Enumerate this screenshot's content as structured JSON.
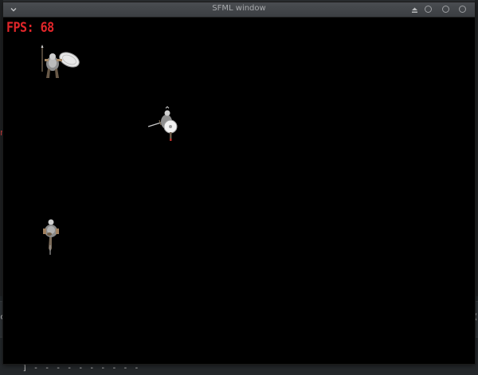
{
  "window": {
    "title": "SFML window",
    "menu_icon": "chevron-down-icon",
    "controls": [
      "eject-icon",
      "minimize-icon",
      "maximize-icon",
      "close-icon"
    ]
  },
  "hud": {
    "fps_label": "FPS: 68",
    "fps_color": "#e2262a"
  },
  "canvas": {
    "background": "#000000"
  },
  "sprites": [
    {
      "name": "knight-with-round-shield",
      "icon": "knight-sprite"
    },
    {
      "name": "knight-with-shield-and-sword",
      "icon": "knight-sprite"
    },
    {
      "name": "footsoldier",
      "icon": "soldier-sprite"
    }
  ],
  "desktop": {
    "left_glyph": "n",
    "left_glyph2": "c",
    "right_glyph": "(",
    "terminal_line": "] - - - - - - - - - -"
  }
}
